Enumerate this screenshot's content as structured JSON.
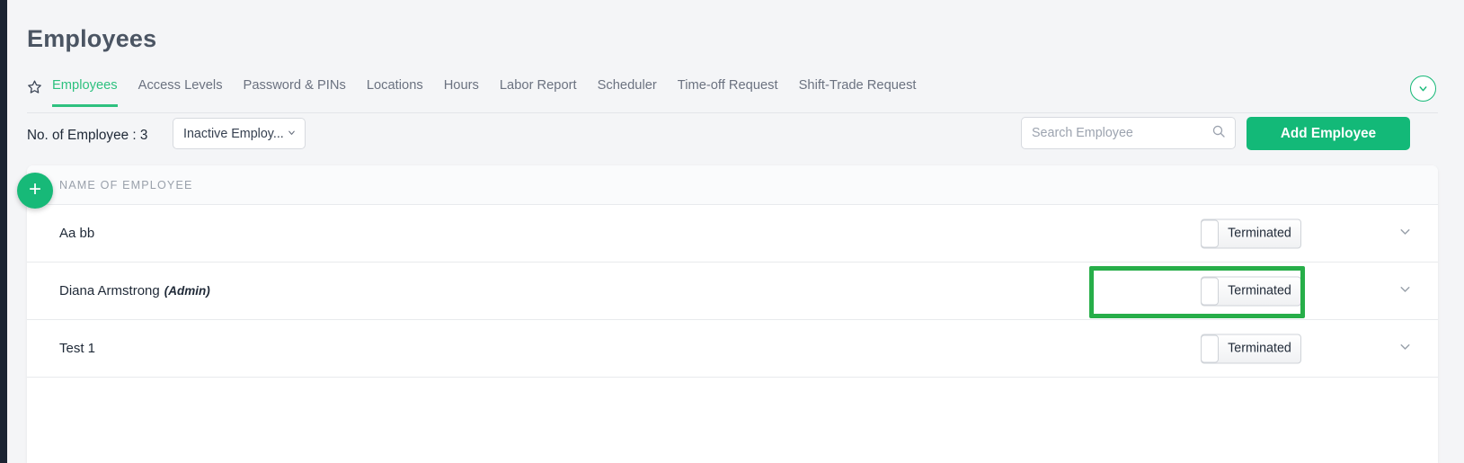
{
  "page": {
    "title": "Employees"
  },
  "tabs": {
    "star_icon": "star-outline-icon",
    "items": [
      {
        "label": "Employees",
        "active": true
      },
      {
        "label": "Access Levels",
        "active": false
      },
      {
        "label": "Password & PINs",
        "active": false
      },
      {
        "label": "Locations",
        "active": false
      },
      {
        "label": "Hours",
        "active": false
      },
      {
        "label": "Labor Report",
        "active": false
      },
      {
        "label": "Scheduler",
        "active": false
      },
      {
        "label": "Time-off Request",
        "active": false
      },
      {
        "label": "Shift-Trade Request",
        "active": false
      }
    ],
    "collapse_icon": "chevron-down-icon"
  },
  "toolbar": {
    "employee_count_label": "No. of Employee : 3",
    "status_filter": {
      "selected": "Inactive Employ...",
      "caret_icon": "chevron-down-icon"
    },
    "search": {
      "value": "",
      "placeholder": "Search Employee",
      "icon": "search-icon"
    },
    "add_employee_label": "Add Employee"
  },
  "table": {
    "add_row_icon": "plus-icon",
    "header": {
      "name_column": "NAME OF EMPLOYEE"
    },
    "rows": [
      {
        "name": "Aa bb",
        "role": "",
        "status_label": "Terminated",
        "chevron_icon": "chevron-down-icon",
        "highlighted": false
      },
      {
        "name": "Diana Armstrong",
        "role": "(Admin)",
        "status_label": "Terminated",
        "chevron_icon": "chevron-down-icon",
        "highlighted": true
      },
      {
        "name": "Test 1",
        "role": "",
        "status_label": "Terminated",
        "chevron_icon": "chevron-down-icon",
        "highlighted": false
      }
    ]
  },
  "colors": {
    "accent_green": "#17b978",
    "active_tab_green": "#2ec17f",
    "highlight_green": "#27ae49",
    "page_bg": "#f4f5f7",
    "rail_dark": "#1b2432"
  }
}
